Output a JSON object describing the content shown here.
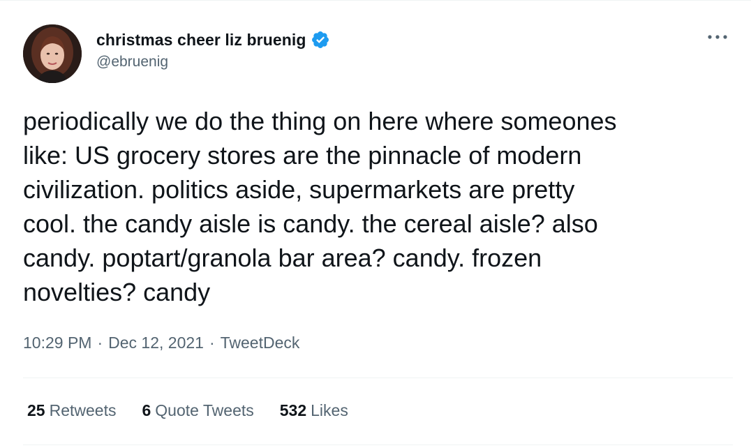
{
  "author": {
    "display_name": "christmas cheer liz bruenig",
    "handle": "@ebruenig",
    "verified": true
  },
  "tweet": {
    "text": "periodically we do the thing on here where someones\nlike: US grocery stores are the pinnacle of modern\ncivilization. politics aside, supermarkets are pretty\ncool. the candy aisle is candy. the cereal aisle? also\ncandy. poptart/granola bar area? candy. frozen\nnovelties? candy",
    "time": "10:29 PM",
    "separator": "·",
    "date": "Dec 12, 2021",
    "source": "TweetDeck"
  },
  "stats": {
    "retweets": {
      "count": "25",
      "label": "Retweets"
    },
    "quotes": {
      "count": "6",
      "label": "Quote Tweets"
    },
    "likes": {
      "count": "532",
      "label": "Likes"
    }
  },
  "colors": {
    "text": "#0f1419",
    "secondary": "#536471",
    "verified": "#1d9bf0",
    "divider": "#eff3f4"
  },
  "icons": {
    "verified": "verified-badge-icon",
    "more": "more-dots-icon"
  }
}
